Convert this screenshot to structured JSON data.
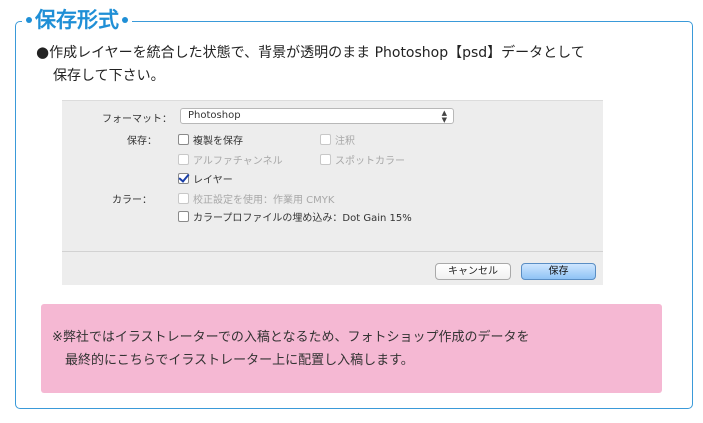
{
  "section": {
    "title": "保存形式"
  },
  "intro": {
    "bullet": "●",
    "line1": "作成レイヤーを統合した状態で、背景が透明のまま Photoshop【psd】データとして",
    "line2": "保存して下さい。"
  },
  "dialog": {
    "format_label": "フォーマット：",
    "format_value": "Photoshop",
    "save_label": "保存：",
    "options": {
      "save_copy": "複製を保存",
      "notes": "注釈",
      "alpha_channels": "アルファチャンネル",
      "spot_colors": "スポットカラー",
      "layers": "レイヤー"
    },
    "color_label": "カラー：",
    "color_options": {
      "proof_setup": "校正設定を使用：作業用 CMYK",
      "icc_profile": "カラープロファイルの埋め込み：Dot Gain 15%"
    },
    "cancel_button": "キャンセル",
    "save_button": "保存"
  },
  "note": {
    "line1": "※弊社ではイラストレーターでの入稿となるため、フォトショップ作成のデータを",
    "line2": "最終的にこちらでイラストレーター上に配置し入稿します。"
  },
  "colors": {
    "accent_blue": "#1f8fd6",
    "note_pink": "#f5b8d3",
    "dialog_bg": "#ededed"
  }
}
